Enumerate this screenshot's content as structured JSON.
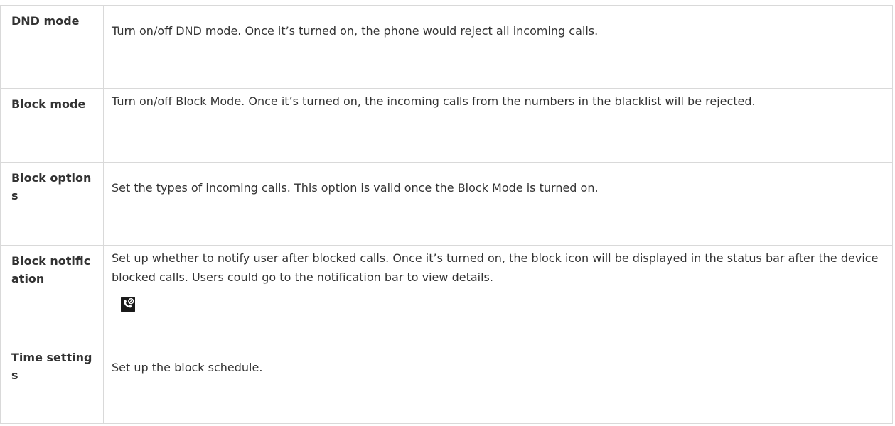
{
  "table": {
    "rows": [
      {
        "name": "DND mode",
        "description": "Turn on/off DND mode. Once it’s turned on, the phone would reject all incoming calls."
      },
      {
        "name": "Block mode",
        "description": "Turn on/off Block Mode. Once it’s turned on, the incoming calls from the numbers in the blacklist will be rejected."
      },
      {
        "name": "Block options",
        "description": "Set the types of incoming calls. This option is valid once the Block Mode is turned on."
      },
      {
        "name": "Block notification",
        "description": "Set up whether to notify user after blocked calls. Once it’s turned on, the block icon will be displayed in the status bar after the device blocked calls. Users could go to the notification bar to view details.",
        "icon": "blocked-call-icon"
      },
      {
        "name": "Time settings",
        "description": "Set up the block schedule."
      }
    ]
  }
}
